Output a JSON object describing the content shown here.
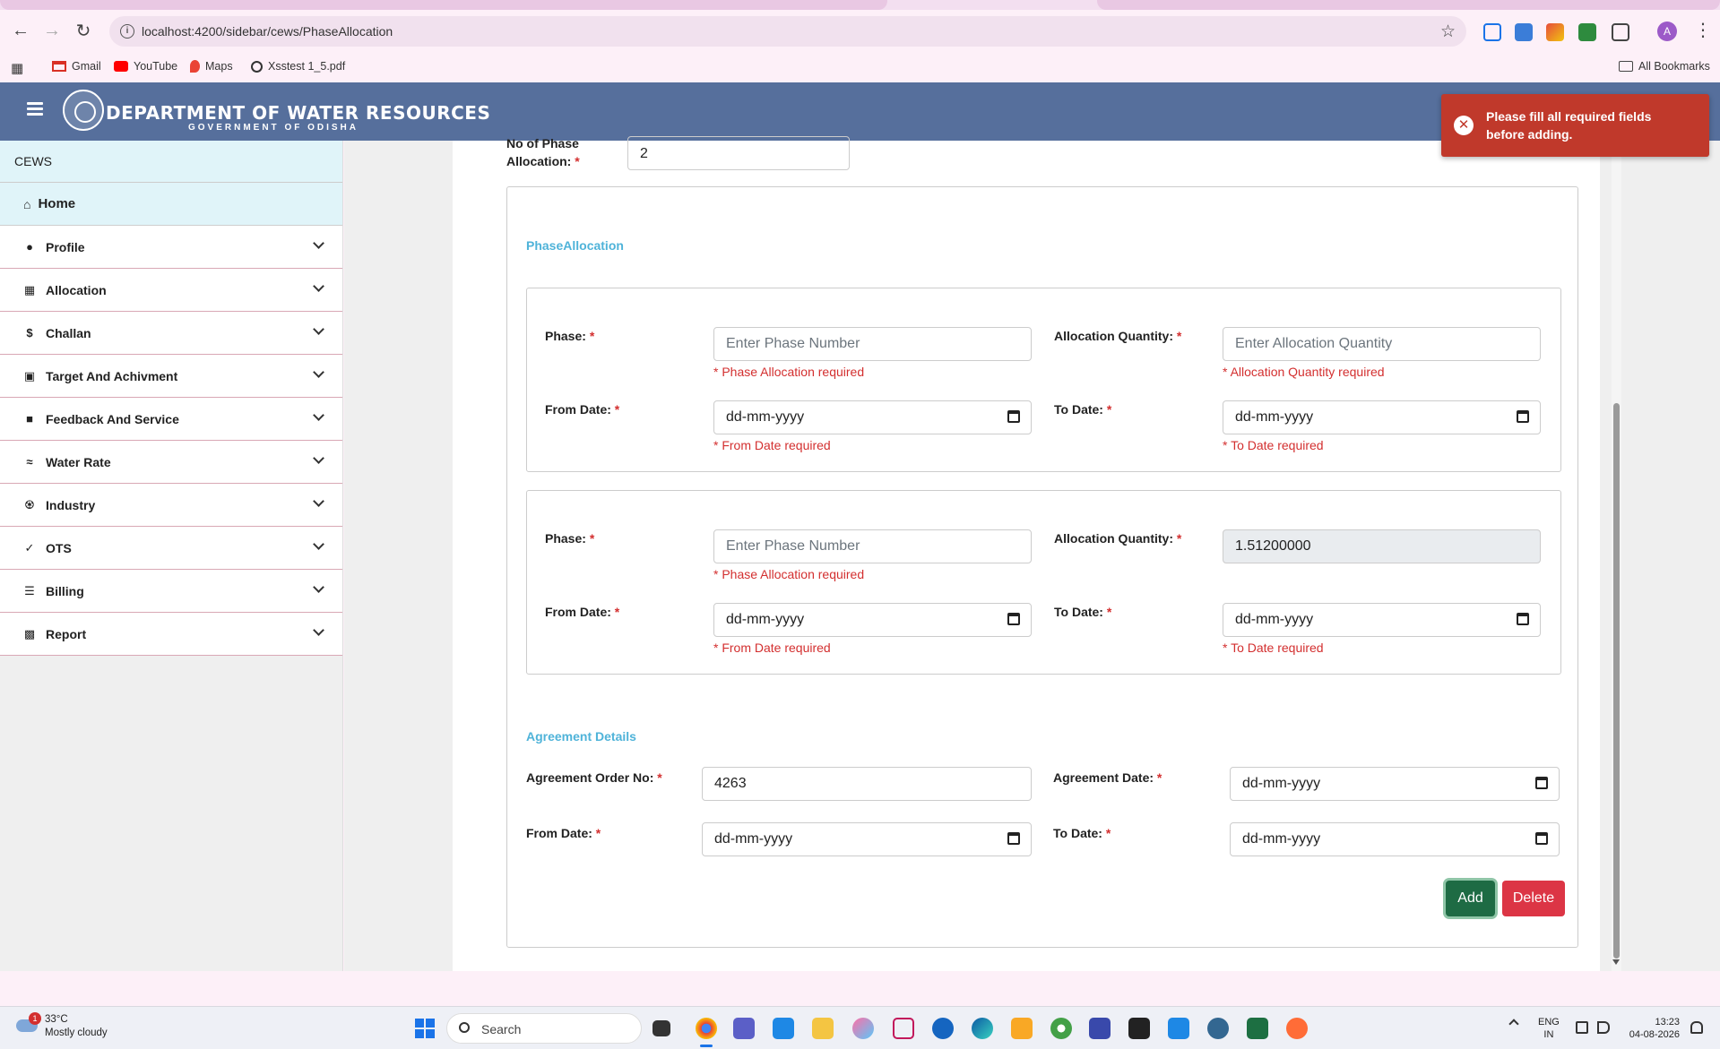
{
  "browser": {
    "url": "localhost:4200/sidebar/cews/PhaseAllocation",
    "bookmarks": [
      "Gmail",
      "YouTube",
      "Maps",
      "Xsstest 1_5.pdf"
    ],
    "all_bookmarks": "All Bookmarks",
    "profile_initial": "A"
  },
  "header": {
    "title": "DEPARTMENT OF WATER RESOURCES",
    "subtitle": "GOVERNMENT OF ODISHA"
  },
  "sidebar": {
    "heading": "CEWS",
    "home": "Home",
    "items": [
      {
        "label": "Profile",
        "icon": "user-circle-icon"
      },
      {
        "label": "Allocation",
        "icon": "document-icon"
      },
      {
        "label": "Challan",
        "icon": "dollar-circle-icon"
      },
      {
        "label": "Target And Achivment",
        "icon": "target-icon"
      },
      {
        "label": "Feedback And Service",
        "icon": "feedback-icon"
      },
      {
        "label": "Water Rate",
        "icon": "water-icon"
      },
      {
        "label": "Industry",
        "icon": "industry-icon"
      },
      {
        "label": "OTS",
        "icon": "check-icon"
      },
      {
        "label": "Billing",
        "icon": "billing-icon"
      },
      {
        "label": "Report",
        "icon": "report-icon"
      }
    ]
  },
  "form": {
    "phase_count_label": "No of Phase Allocation:",
    "phase_count_value": "2",
    "phase_section_title": "PhaseAllocation",
    "phases": [
      {
        "phase_label": "Phase:",
        "phase_placeholder": "Enter Phase Number",
        "phase_error": "* Phase Allocation required",
        "qty_label": "Allocation Quantity:",
        "qty_placeholder": "Enter Allocation Quantity",
        "qty_error": "* Allocation Quantity required",
        "from_label": "From Date:",
        "from_value": "dd-mm-yyyy",
        "from_error": "* From Date required",
        "to_label": "To Date:",
        "to_value": "dd-mm-yyyy",
        "to_error": "* To Date required"
      },
      {
        "phase_label": "Phase:",
        "phase_placeholder": "Enter Phase Number",
        "phase_error": "* Phase Allocation required",
        "qty_label": "Allocation Quantity:",
        "qty_value": "1.51200000",
        "from_label": "From Date:",
        "from_value": "dd-mm-yyyy",
        "from_error": "* From Date required",
        "to_label": "To Date:",
        "to_value": "dd-mm-yyyy",
        "to_error": "* To Date required"
      }
    ],
    "agreement_title": "Agreement Details",
    "agreement_order_label": "Agreement Order No:",
    "agreement_order_value": "4263",
    "agreement_date_label": "Agreement Date:",
    "agreement_date_value": "dd-mm-yyyy",
    "agr_from_label": "From Date:",
    "agr_from_value": "dd-mm-yyyy",
    "agr_to_label": "To Date:",
    "agr_to_value": "dd-mm-yyyy",
    "add_label": "Add",
    "delete_label": "Delete"
  },
  "toast": {
    "message": "Please fill all required fields before adding."
  },
  "taskbar": {
    "temperature": "33°C",
    "weather": "Mostly cloudy",
    "weather_badge": "1",
    "search": "Search",
    "lang1": "ENG",
    "lang2": "IN",
    "time": "13:23",
    "date": "04-08-2026"
  },
  "colors": {
    "header_bg": "#566f9c",
    "accent": "#4fb3d9",
    "error": "#d32f2f",
    "add_button": "#1e6b44",
    "delete_button": "#dc3545",
    "toast": "#c0392b"
  }
}
